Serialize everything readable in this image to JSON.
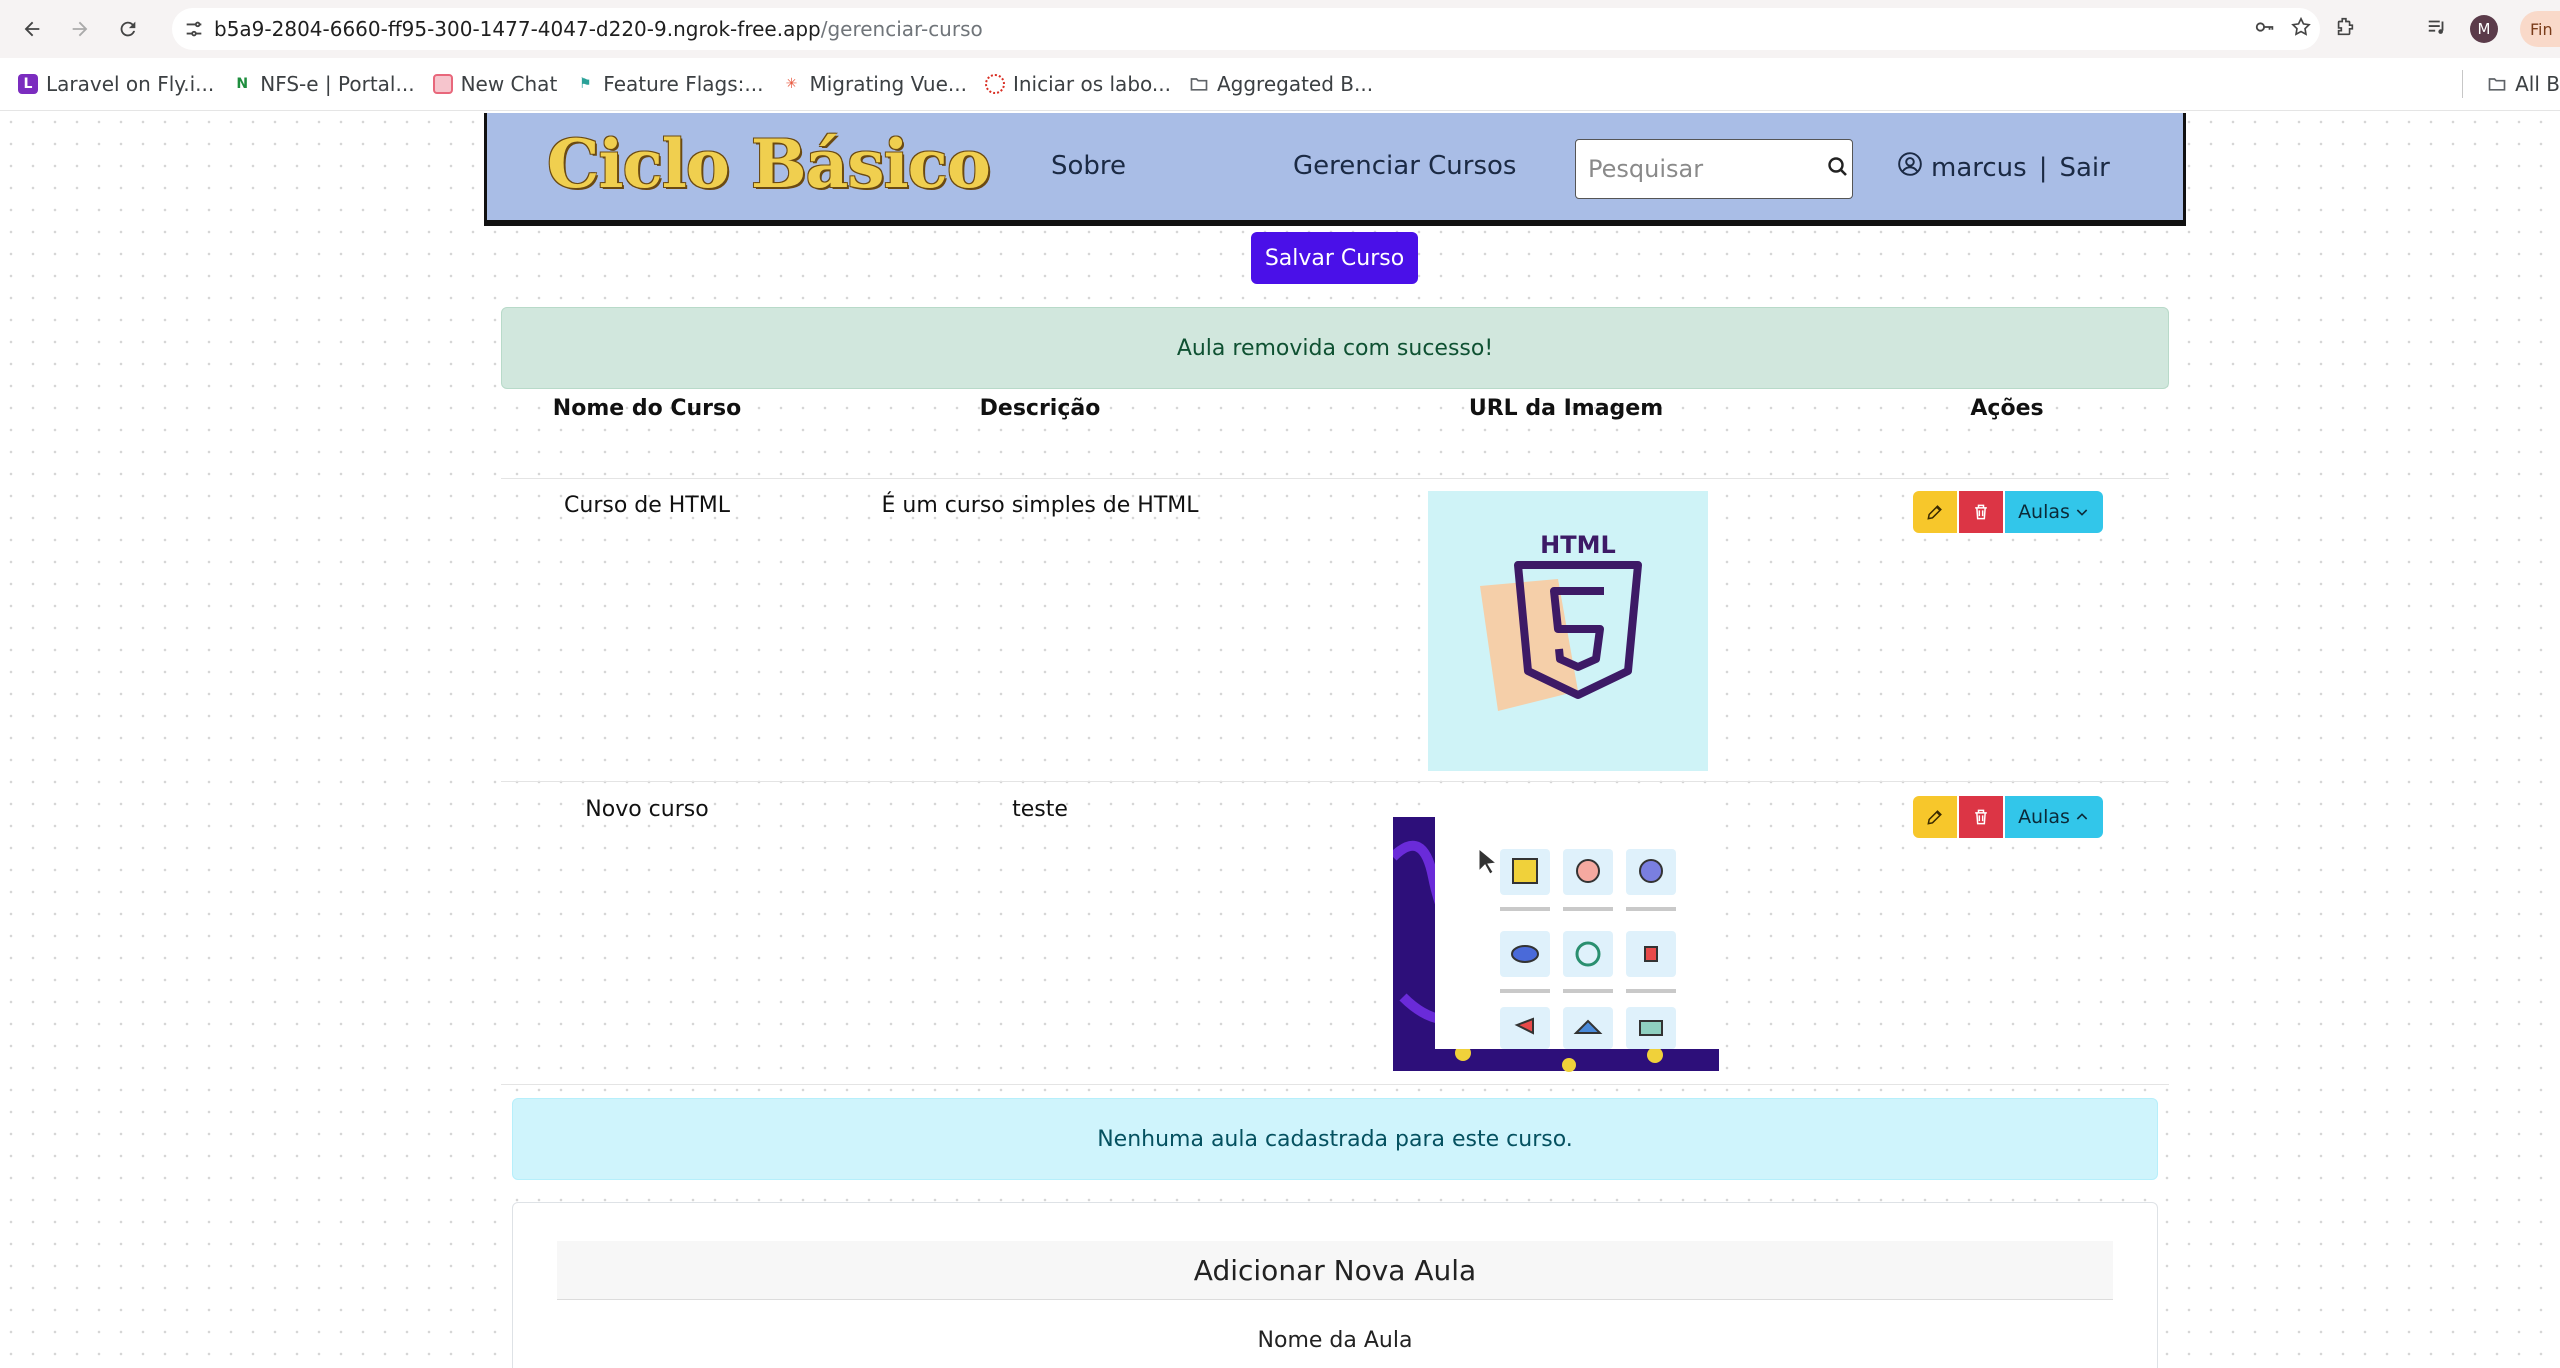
{
  "browser": {
    "url_host": "b5a9-2804-6660-ff95-300-1477-4047-d220-9.ngrok-free.app",
    "url_path": "/gerenciar-curso",
    "profile_initial": "M",
    "profile_label": "Fin",
    "bookmarks": [
      {
        "label": "Laravel on Fly.i...",
        "icon": "laravel-icon",
        "color": "#7b2cbf"
      },
      {
        "label": "NFS-e | Portal...",
        "icon": "nfse-icon",
        "color": "#1e8e3e"
      },
      {
        "label": "New Chat",
        "icon": "chat-icon",
        "color": "#e8677b"
      },
      {
        "label": "Feature Flags:...",
        "icon": "feature-flags-icon",
        "color": "#2aa198"
      },
      {
        "label": "Migrating Vue...",
        "icon": "vue-icon",
        "color": "#e8553b"
      },
      {
        "label": "Iniciar os labo...",
        "icon": "lab-icon",
        "color": "#d93025"
      },
      {
        "label": "Aggregated B...",
        "icon": "folder-icon",
        "color": "#5f6368"
      }
    ],
    "all_bookmarks_label": "All B"
  },
  "header": {
    "logo_text": "Ciclo Básico",
    "nav_sobre": "Sobre",
    "nav_gerenciar": "Gerenciar Cursos",
    "search_placeholder": "Pesquisar",
    "username": "marcus",
    "separator": "|",
    "logout": "Sair"
  },
  "save_button_label": "Salvar Curso",
  "success_message": "Aula removida com sucesso!",
  "table": {
    "headers": [
      "Nome do Curso",
      "Descrição",
      "URL da Imagem",
      "Ações"
    ],
    "rows": [
      {
        "name": "Curso de HTML",
        "description": "É um curso simples de HTML",
        "image": "html5-course-image"
      },
      {
        "name": "Novo curso",
        "description": "teste",
        "image": "course-icons-collage-image"
      }
    ],
    "aulas_label": "Aulas"
  },
  "html_thumb_text": "HTML",
  "no_lessons_message": "Nenhuma aula cadastrada para este curso.",
  "new_lesson": {
    "title": "Adicionar Nova Aula",
    "name_label": "Nome da Aula"
  },
  "colors": {
    "header_bg": "#a9bde6",
    "save_button": "#4a10e8",
    "success_bg": "#d1e7dd",
    "info_bg": "#cff4fc",
    "edit_button": "#f7c72b",
    "delete_button": "#dc3545",
    "aulas_button": "#32c6ea"
  }
}
